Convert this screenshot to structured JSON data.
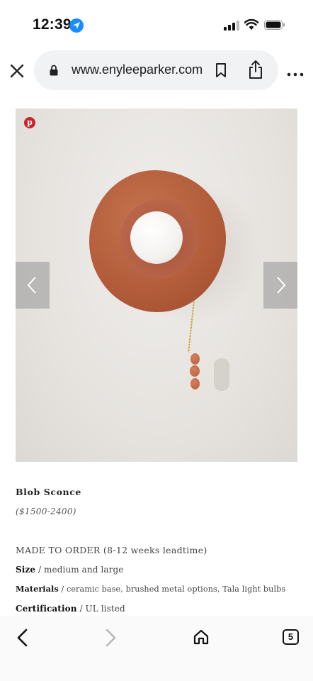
{
  "status_bar": {
    "time": "12:39"
  },
  "browser": {
    "url": "www.enyleeparker.com",
    "tab_count": "5"
  },
  "product": {
    "name": "Blob Sconce",
    "price": "($1500-2400)",
    "order_note": "MADE TO ORDER (8-12 weeks leadtime)",
    "specs": [
      {
        "label": "Size",
        "value": " / medium and large"
      },
      {
        "label": "Materials",
        "value": " / ceramic base, brushed metal options, Tala light bulbs"
      },
      {
        "label": "Certification",
        "value": " / UL listed"
      }
    ]
  },
  "colors": {
    "pinterest": "#c8232c",
    "location_accent": "#1a8cff",
    "terracotta": "#b35d3b"
  }
}
